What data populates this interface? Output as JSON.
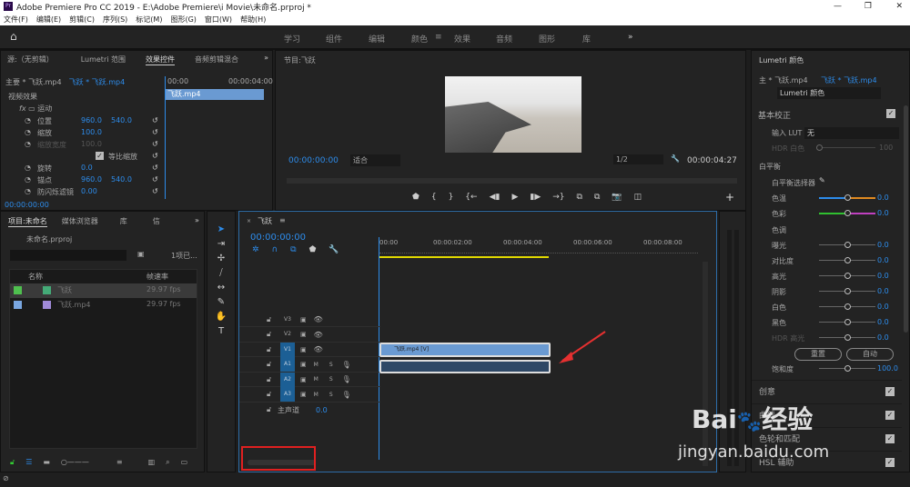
{
  "app": {
    "title": "Adobe Premiere Pro CC 2019 - E:\\Adobe Premiere\\i Movie\\未命名.prproj *",
    "icon": "Pr"
  },
  "menu": [
    "文件(F)",
    "编辑(E)",
    "剪辑(C)",
    "序列(S)",
    "标记(M)",
    "图形(G)",
    "窗口(W)",
    "帮助(H)"
  ],
  "workspaces": [
    "学习",
    "组件",
    "编辑",
    "颜色",
    "效果",
    "音频",
    "图形",
    "库"
  ],
  "active_workspace": "颜色",
  "effect_panel": {
    "tabs": [
      "源:（无剪辑）",
      "Lumetri 范围",
      "效果控件",
      "音频剪辑混合"
    ],
    "master": "主要 * 飞跃.mp4",
    "clip": "飞跃 * 飞跃.mp4",
    "mini_time_start": "00:00",
    "mini_time_end": "00:00:04:00",
    "mini_clip": "飞跃.mp4",
    "section": "视频效果",
    "motion": "运动",
    "props": [
      {
        "name": "位置",
        "v1": "960.0",
        "v2": "540.0"
      },
      {
        "name": "缩放",
        "v1": "100.0",
        "v2": ""
      },
      {
        "name": "缩放宽度",
        "v1": "100.0",
        "v2": ""
      },
      {
        "name": "等比缩放",
        "v1": "",
        "v2": ""
      },
      {
        "name": "旋转",
        "v1": "0.0",
        "v2": ""
      },
      {
        "name": "锚点",
        "v1": "960.0",
        "v2": "540.0"
      },
      {
        "name": "防闪烁滤镜",
        "v1": "0.00",
        "v2": ""
      }
    ],
    "timecode": "00:00:00:00"
  },
  "program": {
    "title": "节目:飞跃",
    "timecode": "00:00:00:00",
    "fit": "适合",
    "resolution": "1/2",
    "duration": "00:00:04:27"
  },
  "lumetri": {
    "title": "Lumetri 颜色",
    "master": "主 * 飞跃.mp4",
    "clip": "飞跃 * 飞跃.mp4",
    "effect": "Lumetri 颜色",
    "basic": "基本校正",
    "lut_label": "输入 LUT",
    "lut_value": "无",
    "hdr_white": "HDR 白色",
    "hdr_white_val": "100",
    "wb": "白平衡",
    "wb_picker": "白平衡选择器",
    "wb_sliders": [
      {
        "name": "色温",
        "value": "0.0"
      },
      {
        "name": "色彩",
        "value": "0.0"
      }
    ],
    "tone": "色调",
    "tone_sliders": [
      {
        "name": "曝光",
        "value": "0.0"
      },
      {
        "name": "对比度",
        "value": "0.0"
      },
      {
        "name": "高光",
        "value": "0.0"
      },
      {
        "name": "阴影",
        "value": "0.0"
      },
      {
        "name": "白色",
        "value": "0.0"
      },
      {
        "name": "黑色",
        "value": "0.0"
      },
      {
        "name": "HDR 高光",
        "value": "0.0"
      }
    ],
    "reset": "重置",
    "auto": "自动",
    "saturation": "饱和度",
    "saturation_val": "100.0",
    "sections": [
      "创意",
      "曲线",
      "色轮和匹配",
      "HSL 辅助"
    ]
  },
  "project": {
    "tabs": [
      "项目:未命名",
      "媒体浏览器",
      "库",
      "信"
    ],
    "file": "未命名.prproj",
    "count": "1项已...",
    "search_placeholder": "",
    "col_name": "名称",
    "col_fps": "帧速率",
    "items": [
      {
        "name": "飞跃",
        "fps": "29.97 fps",
        "color": "#4fc04f"
      },
      {
        "name": "飞跃.mp4",
        "fps": "29.97 fps",
        "color": "#79a6e0"
      }
    ]
  },
  "timeline": {
    "title": "飞跃",
    "timecode": "00:00:00:00",
    "ruler": [
      "00:00",
      "00:00:02:00",
      "00:00:04:00",
      "00:00:06:00",
      "00:00:08:00"
    ],
    "video_tracks": [
      "V3",
      "V2",
      "V1"
    ],
    "audio_tracks": [
      "A1",
      "A2",
      "A3"
    ],
    "master": "主声道",
    "master_val": "0.0",
    "m": "M",
    "s": "S",
    "video_clip": "飞跃.mp4 [V]"
  },
  "watermark": {
    "brand": "Bai du 经验",
    "url": "jingyan.baidu.com"
  }
}
